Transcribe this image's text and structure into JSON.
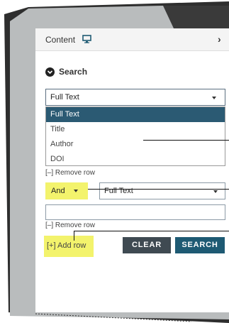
{
  "panel": {
    "title": "Content",
    "icon": "monitor-icon",
    "expand_icon": "chevron-right-icon"
  },
  "search": {
    "heading": "Search",
    "heading_icon": "circle-chevron-down-icon",
    "field_select": {
      "value": "Full Text",
      "options": [
        "Full Text",
        "Title",
        "Author",
        "DOI"
      ],
      "selected_index": 0
    },
    "remove_row_label": "[–] Remove row",
    "operator_select": {
      "value": "And"
    },
    "second_field_select": {
      "value": "Full Text"
    },
    "second_input": {
      "value": ""
    },
    "remove_row_label_2": "[–] Remove row",
    "add_row_label": "[+] Add row",
    "clear_button": "CLEAR",
    "search_button": "SEARCH"
  },
  "colors": {
    "accent": "#1e5a73",
    "selected_option": "#2b5a73",
    "clear_button": "#3f4a52",
    "highlight": "#f3f36c"
  }
}
